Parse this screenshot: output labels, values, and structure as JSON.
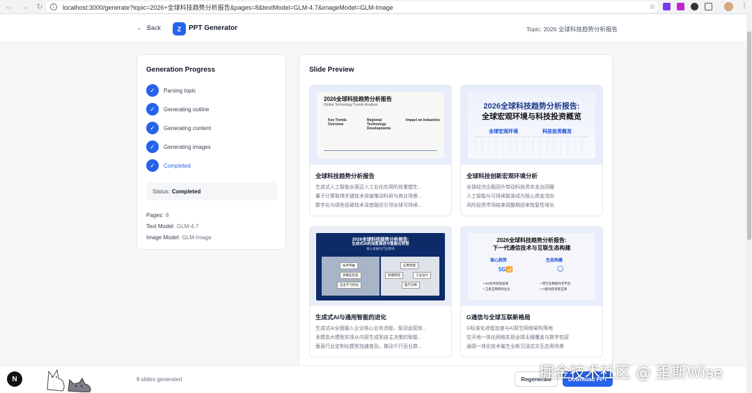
{
  "browser": {
    "url": "localhost:3000/generate?topic=2026+全球科技趋势分析报告&pages=8&textModel=GLM-4.7&imageModel=GLM-Image"
  },
  "header": {
    "back_label": "Back",
    "logo_letter": "Z",
    "app_name": "PPT Generator",
    "topic_label": "Topic: 2026 全球科技趋势分析报告"
  },
  "progress": {
    "title": "Generation Progress",
    "steps": [
      {
        "label": "Parsing topic"
      },
      {
        "label": "Generating outline"
      },
      {
        "label": "Generating content"
      },
      {
        "label": "Generating images"
      },
      {
        "label": "Completed"
      }
    ],
    "status_label": "Status:",
    "status_value": "Completed",
    "pages_label": "Pages:",
    "pages_value": "8",
    "text_model_label": "Text Model:",
    "text_model_value": "GLM-4.7",
    "image_model_label": "Image Model:",
    "image_model_value": "GLM-Image"
  },
  "preview": {
    "title": "Slide Preview",
    "slides": [
      {
        "title": "全球科技趋势分析报告",
        "bullets": [
          "生成式人工智能全面迈入工业化应用阶段重塑生...",
          "量子计算取得关键技术突破推动科研与商业场景...",
          "数字化与绿色低碳技术深度融合引领全球可持续..."
        ],
        "thumb": {
          "h": "2026全球科技趋势分析报告",
          "s": "Global Technology Trends Analysis",
          "c1": "Key Trends Overview",
          "c2": "Regional Technology Developments",
          "c3": "Impact on Industries"
        }
      },
      {
        "title": "全球科技创新宏观环境分析",
        "bullets": [
          "全球经济企稳回升带动科技资本支出回暖",
          "人工智能与可持续能源成为核心资金流向",
          "风险投资市场结束调整期迎来恢复性增长"
        ],
        "thumb": {
          "h1": "2026全球科技趋势分析报告:",
          "h2": "全球宏观环境与科技投资概览",
          "t1": "全球宏观环境",
          "t2": "科技投资概览"
        }
      },
      {
        "title": "生成式AI与通用智能的进化",
        "bullets": [
          "生成式AI全面融入企业核心业务流程，驱动运营效...",
          "多模态大模型实现从内容生成到自主决策的智能...",
          "垂直行业定制化模型加速普及，推动千行百业数..."
        ],
        "thumb": {
          "h1": "2026全球科技趋势分析报告:",
          "h2": "生成式AI的深度演进与智能化转型",
          "h3": "核心发展与行业影响",
          "a": "技术突破",
          "b": "应用场景",
          "c": "多模态生成",
          "d": "智能制造",
          "e": "工业设计",
          "f": "自主学习优化",
          "g": "医疗诊断"
        }
      },
      {
        "title": "G通信与全球互联新格局",
        "bullets": [
          "G标准化进程加速与AI原生网络架构落地",
          "空天地一体化网络实现全球无缝覆盖与数字包容",
          "通感一体化技术催生全新沉浸式交互应用场景"
        ],
        "thumb": {
          "h1": "2026全球科技趋势分析报告:",
          "h2": "下一代通信技术与互联生态构建",
          "l1": "核心趋势",
          "l2": "生态构建",
          "n5": "5G",
          "x1": "• 6G技术研发加速",
          "x2": "• 卫星互联网商业化",
          "y1": "• 跨行业数据共享平台",
          "y2": "• AI驱动的智能互联"
        }
      }
    ]
  },
  "footer": {
    "slides_count": "8 slides generated",
    "regenerate_label": "Regenerate",
    "download_label": "Download PPT",
    "next_logo": "N"
  },
  "watermark": "掘金技术社区 @ 歪斯Wise",
  "colors": {
    "accent": "#2563eb",
    "background": "#f5f6f8"
  }
}
